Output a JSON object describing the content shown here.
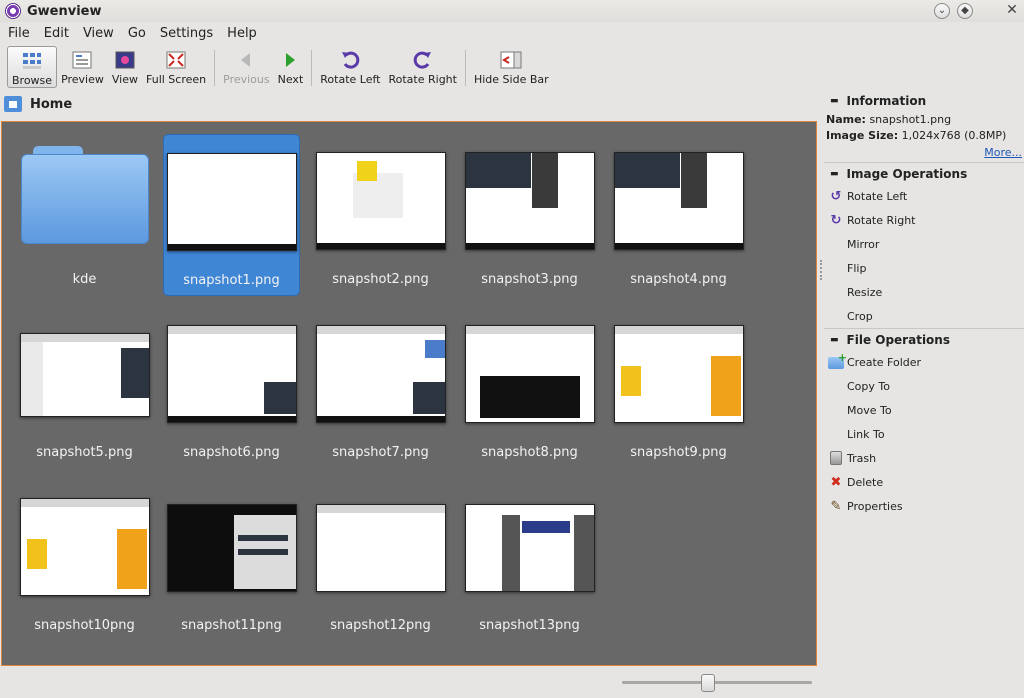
{
  "window": {
    "title": "Gwenview"
  },
  "menu": [
    "File",
    "Edit",
    "View",
    "Go",
    "Settings",
    "Help"
  ],
  "toolbar": {
    "browse": "Browse",
    "preview": "Preview",
    "view": "View",
    "fullscreen": "Full Screen",
    "previous": "Previous",
    "next": "Next",
    "rotate_left": "Rotate Left",
    "rotate_right": "Rotate Right",
    "hide_sidebar": "Hide Side Bar"
  },
  "breadcrumb": {
    "label": "Home"
  },
  "items": [
    {
      "name": "kde",
      "kind": "folder"
    },
    {
      "name": "snapshot1.png",
      "selected": true
    },
    {
      "name": "snapshot2.png"
    },
    {
      "name": "snapshot3.png"
    },
    {
      "name": "snapshot4.png"
    },
    {
      "name": "snapshot5.png"
    },
    {
      "name": "snapshot6.png"
    },
    {
      "name": "snapshot7.png"
    },
    {
      "name": "snapshot8.png"
    },
    {
      "name": "snapshot9.png"
    },
    {
      "name": "snapshot10png"
    },
    {
      "name": "snapshot11png"
    },
    {
      "name": "snapshot12png"
    },
    {
      "name": "snapshot13png"
    }
  ],
  "sidebar": {
    "information": {
      "header": "Information",
      "name_label": "Name:",
      "name_value": "snapshot1.png",
      "size_label": "Image Size:",
      "size_value": "1,024x768 (0.8MP)",
      "more": "More..."
    },
    "image_ops": {
      "header": "Image Operations",
      "items": [
        "Rotate Left",
        "Rotate Right",
        "Mirror",
        "Flip",
        "Resize",
        "Crop"
      ]
    },
    "file_ops": {
      "header": "File Operations",
      "items": [
        "Create Folder",
        "Copy To",
        "Move To",
        "Link To",
        "Trash",
        "Delete",
        "Properties"
      ]
    }
  },
  "zoom": {
    "level": 0.45
  },
  "colors": {
    "accent_selection": "#3f86d5",
    "grid_bg": "#686868",
    "grid_border": "#e0863a"
  }
}
